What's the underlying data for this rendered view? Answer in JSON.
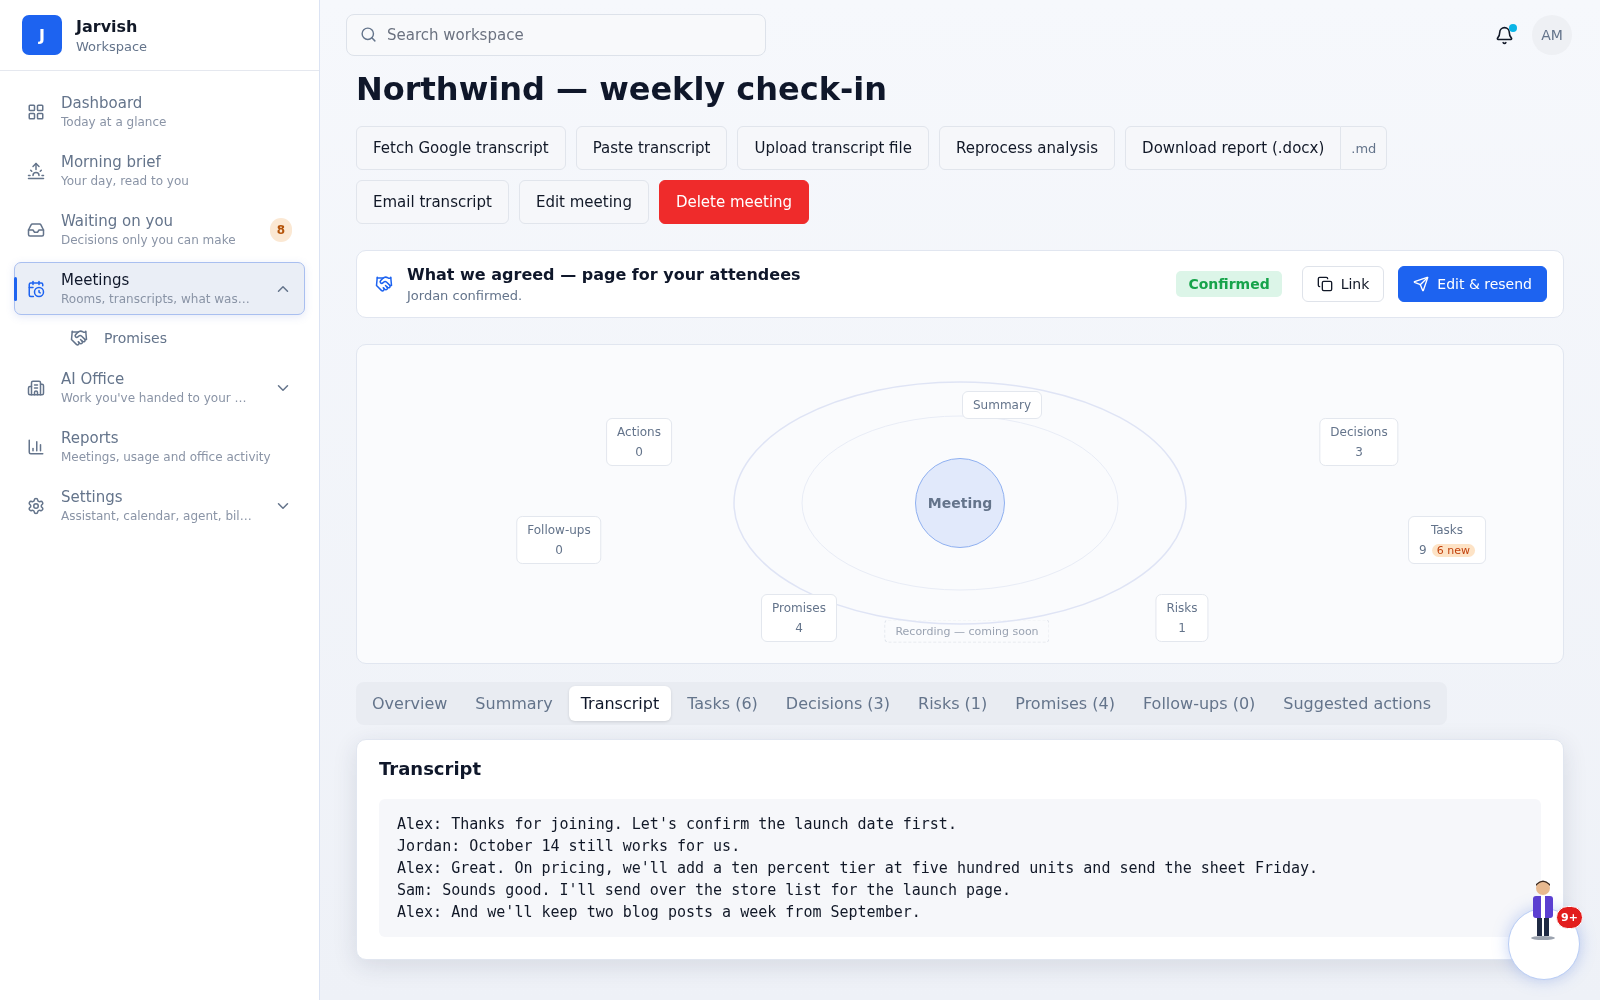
{
  "brand": {
    "initial": "J",
    "name": "Jarvish",
    "subtitle": "Workspace"
  },
  "nav": [
    {
      "label": "Dashboard",
      "sub": "Today at a glance",
      "selected": false
    },
    {
      "label": "Morning brief",
      "sub": "Your day, read to you",
      "selected": false
    },
    {
      "label": "Waiting on you",
      "sub": "Decisions only you can make",
      "badge": "8",
      "selected": false
    },
    {
      "label": "Meetings",
      "sub": "Rooms, transcripts, what was…",
      "selected": true,
      "expanded": true,
      "children": [
        {
          "label": "Promises",
          "selected": false
        }
      ]
    },
    {
      "label": "AI Office",
      "sub": "Work you've handed to your …",
      "selected": false,
      "expanded": false
    },
    {
      "label": "Reports",
      "sub": "Meetings, usage and office activity",
      "selected": false
    },
    {
      "label": "Settings",
      "sub": "Assistant, calendar, agent, bil…",
      "selected": false,
      "expanded": false
    }
  ],
  "search": {
    "placeholder": "Search workspace"
  },
  "user": {
    "initials": "AM",
    "notifications": true
  },
  "title": "Northwind — weekly check-in",
  "actions": [
    {
      "label": "Fetch Google transcript",
      "kind": "default"
    },
    {
      "label": "Paste transcript",
      "kind": "default"
    },
    {
      "label": "Upload transcript file",
      "kind": "default"
    },
    {
      "label": "Reprocess analysis",
      "kind": "default"
    },
    {
      "label": "Download report (.docx)",
      "kind": "split",
      "extra": ".md"
    },
    {
      "label": "Email transcript",
      "kind": "default"
    },
    {
      "label": "Edit meeting",
      "kind": "default"
    },
    {
      "label": "Delete meeting",
      "kind": "danger"
    }
  ],
  "agreement": {
    "title": "What we agreed — page for your attendees",
    "sub": "Jordan confirmed.",
    "status": "Confirmed",
    "link": "Link",
    "resend": "Edit & resend"
  },
  "graph": {
    "center": "Meeting",
    "nodes": [
      {
        "label": "Summary"
      },
      {
        "label": "Actions",
        "value": "0"
      },
      {
        "label": "Decisions",
        "value": "3"
      },
      {
        "label": "Follow-ups",
        "value": "0"
      },
      {
        "label": "Tasks",
        "value": "9",
        "badge": "6 new"
      },
      {
        "label": "Promises",
        "value": "4"
      },
      {
        "label": "Risks",
        "value": "1"
      }
    ],
    "recording": "Recording — coming soon"
  },
  "tabs": [
    {
      "label": "Overview",
      "selected": false
    },
    {
      "label": "Summary",
      "selected": false
    },
    {
      "label": "Transcript",
      "selected": true
    },
    {
      "label": "Tasks (6)",
      "selected": false
    },
    {
      "label": "Decisions (3)",
      "selected": false
    },
    {
      "label": "Risks (1)",
      "selected": false
    },
    {
      "label": "Promises (4)",
      "selected": false
    },
    {
      "label": "Follow-ups (0)",
      "selected": false
    },
    {
      "label": "Suggested actions",
      "selected": false
    }
  ],
  "transcript": {
    "heading": "Transcript",
    "lines": [
      "Alex: Thanks for joining. Let's confirm the launch date first.",
      "Jordan: October 14 still works for us.",
      "Alex: Great. On pricing, we'll add a ten percent tier at five hundred units and send the sheet Friday.",
      "Sam: Sounds good. I'll send over the store list for the launch page.",
      "Alex: And we'll keep two blog posts a week from September."
    ]
  },
  "assistant": {
    "badge": "9+"
  }
}
